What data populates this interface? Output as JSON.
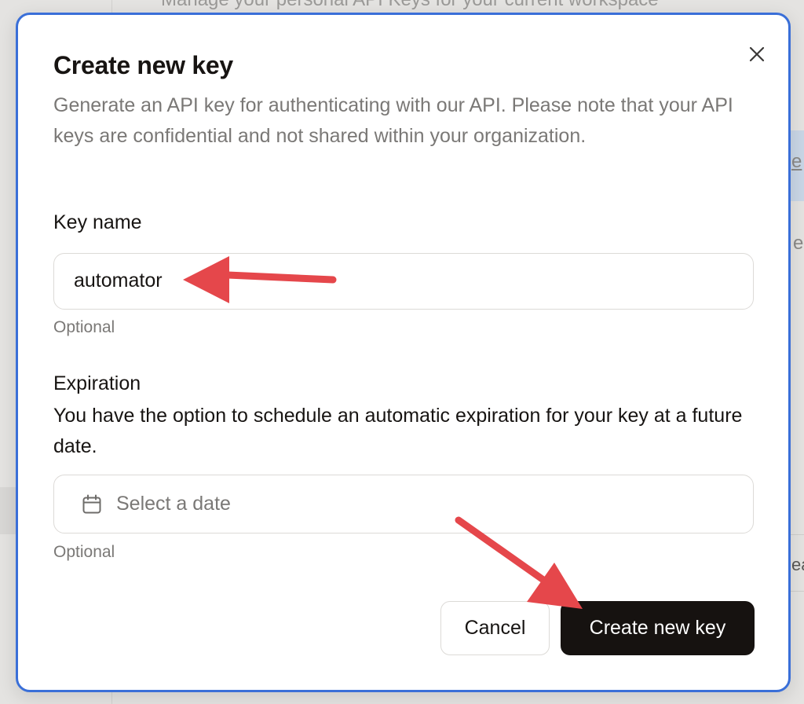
{
  "background": {
    "top_text": "Manage your personal API Keys for your current workspace",
    "strip_text": "e",
    "side_text": "e",
    "side_text2": "ea"
  },
  "dialog": {
    "title": "Create new key",
    "description": "Generate an API key for authenticating with our API. Please note that your API keys are confidential and not shared within your organization.",
    "close_icon": "close-icon",
    "key_name": {
      "label": "Key name",
      "value": "automator",
      "hint": "Optional"
    },
    "expiration": {
      "label": "Expiration",
      "description": "You have the option to schedule an automatic expiration for your key at a future date.",
      "placeholder": "Select a date",
      "icon": "calendar-icon",
      "hint": "Optional"
    },
    "buttons": {
      "cancel": "Cancel",
      "create": "Create new key"
    }
  },
  "colors": {
    "dialog_border": "#3a6fd8",
    "primary_button": "#161210",
    "annotation_arrow": "#e5474b"
  }
}
